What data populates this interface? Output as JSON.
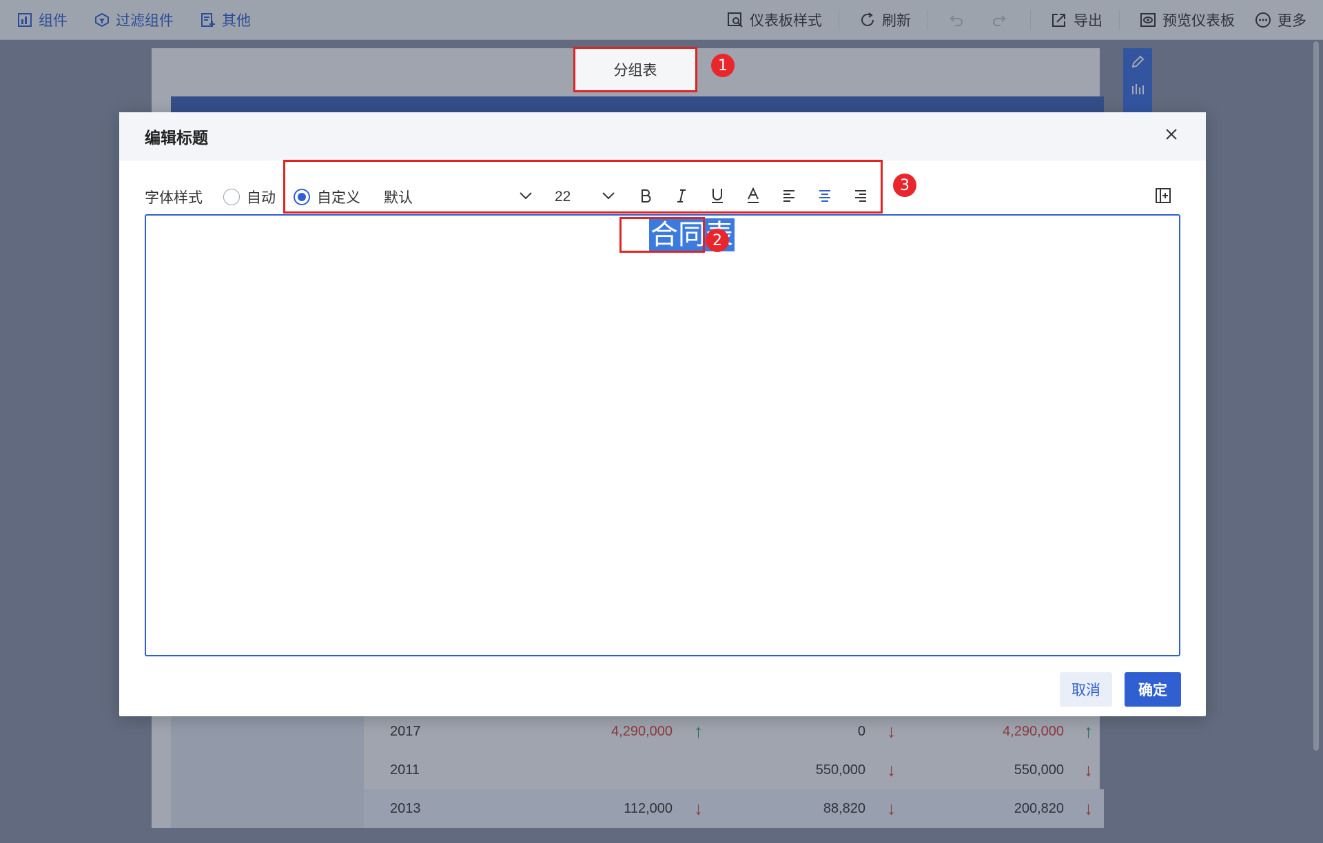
{
  "toolbar": {
    "left": [
      {
        "label": "组件",
        "icon": "chart-component-icon"
      },
      {
        "label": "过滤组件",
        "icon": "filter-component-icon"
      },
      {
        "label": "其他",
        "icon": "other-add-icon"
      }
    ],
    "right": [
      {
        "label": "仪表板样式",
        "icon": "dashboard-style-icon"
      },
      {
        "label": "刷新",
        "icon": "refresh-icon"
      },
      {
        "label": "导出",
        "icon": "export-icon"
      },
      {
        "label": "预览仪表板",
        "icon": "preview-icon"
      },
      {
        "label": "更多",
        "icon": "more-icon"
      }
    ]
  },
  "dashboard": {
    "component_title": "分组表",
    "rows": [
      {
        "year": "2017",
        "v1": "4,290,000",
        "v2": "0",
        "v3": "4,290,000"
      },
      {
        "year": "2011",
        "v1": "",
        "v2": "550,000",
        "v3": "550,000"
      },
      {
        "year": "2013",
        "v1": "112,000",
        "v2": "88,820",
        "v3": "200,820"
      }
    ]
  },
  "badges": {
    "b1": "1",
    "b2": "2",
    "b3": "3"
  },
  "dialog": {
    "title": "编辑标题",
    "font_style_label": "字体样式",
    "radio_auto": "自动",
    "radio_custom": "自定义",
    "font_family": "默认",
    "font_size": "22",
    "editor_text": "合同表",
    "cancel": "取消",
    "confirm": "确定"
  },
  "colors": {
    "primary": "#2f5fd0",
    "highlight": "#e02424",
    "up": "#22a06b",
    "down": "#d6403a"
  }
}
